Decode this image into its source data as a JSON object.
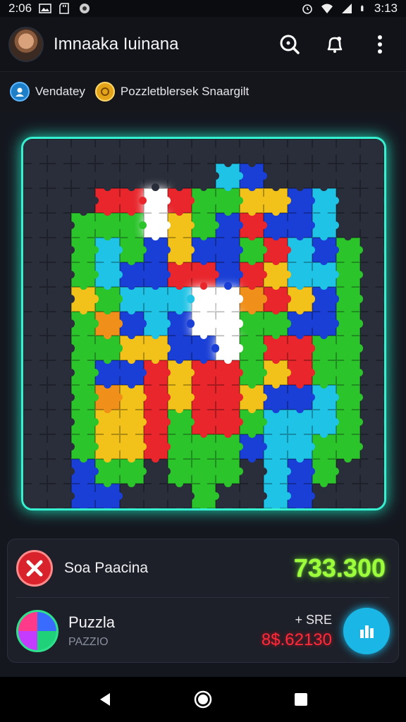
{
  "status_bar": {
    "time_left": "2:06",
    "time_right": "3:13",
    "icons": [
      "image-icon",
      "sd-card-icon",
      "record-icon",
      "alarm-icon",
      "wifi-icon",
      "signal-icon",
      "battery-icon"
    ]
  },
  "header": {
    "title": "Imnaaka Iuinana",
    "avatar": "user-avatar",
    "actions": [
      "search-icon",
      "bell-icon",
      "more-vert-icon"
    ]
  },
  "tags": [
    {
      "label": "Vendatey",
      "icon": "profile-badge-icon",
      "color": "#1e7fc8"
    },
    {
      "label": "Pozzletblersek Snaargilt",
      "icon": "coin-icon",
      "color": "#e4a41a"
    }
  ],
  "board": {
    "columns": 15,
    "rows": 15,
    "palette": {
      "R": "#e8262c",
      "G": "#2bc42b",
      "B": "#1a3fd6",
      "Y": "#f2c21a",
      "C": "#1fc3e6",
      "O": "#f0901a",
      "W": "#ffffff",
      "D": "#2a2e3a"
    },
    "grid": [
      "DDDDDDDDDDDDDDD",
      "DDDDDDDDCBDDDDD",
      "DDDRRWRGGYYBCDD",
      "DDGGGWYGBRBBCDD",
      "DDGCGBYBBGRCBGD",
      "DDGCBBRRBRYCCGD",
      "DDYGCCCWWORYBGD",
      "DDGOBCBWWGGBBGD",
      "DDGGYYBBWGRRGGD",
      "DDGBBRYRRGYRGGD",
      "DDGOYRYRRYBBCGD",
      "DDGYYRGRRGCCCGD",
      "DDGYYRGGGBCCGGD",
      "DDBGGDGGGDCBGDD",
      "DDBBDDDGDDCBDDD"
    ]
  },
  "panel": {
    "row1": {
      "label": "Soa Paacina",
      "score": "733.300",
      "close_icon": "close-icon"
    },
    "row2": {
      "title": "Puzzla",
      "subtitle": "PAZZIO",
      "price_label": "+ SRE",
      "price_value": "8$.62130",
      "action_icon": "stats-bars-icon"
    }
  },
  "colors": {
    "accent": "#36f0d0",
    "score": "#9dff3a",
    "price": "#ff2a3a",
    "action": "#19b6e6"
  },
  "nav": [
    "back-icon",
    "home-icon",
    "recents-icon"
  ]
}
